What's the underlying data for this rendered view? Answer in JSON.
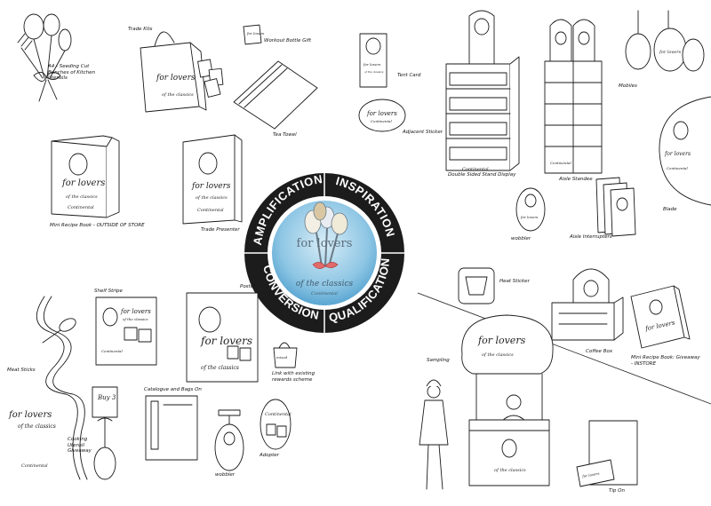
{
  "hub": {
    "ring_words": [
      "AMPLIFICATION",
      "INSPIRATION",
      "QUALIFICATION",
      "CONVERSION"
    ],
    "logo_line1": "for lovers",
    "logo_line2": "of the classics",
    "brand": "Continental"
  },
  "labels": {
    "kitchen_utensils": "A4 - Seeding Cut Bunches of Kitchen Utensils",
    "trade_kits": "Trade Kits",
    "workout_bottle": "Workout Bottle Gift",
    "tea_towel": "Tea Towel",
    "tent_card": "Tent Card",
    "adjacent_sticker": "Adjacent Sticker",
    "floor_stand": "Double Sided Stand Display",
    "aisle_standee": "Aisle Standee",
    "mobiles": "Mobiles",
    "blade": "Blade",
    "wobbler_top": "wobbler",
    "aisle_interrupters": "Aisle Interrupters",
    "mini_recipe_book_top": "Mini Recipe Book - OUTSIDE OF STORE",
    "trade_presenter": "Trade Presenter",
    "shelf_stripe": "Shelf Stripe",
    "poster": "Poster",
    "meat_stick": "Meat Sticks",
    "cataloges": "Catalogue and Bags On",
    "adopter": "Adopter",
    "wobbler_bottom": "wobbler",
    "link_existing": "Link with existing rewards scheme",
    "cooking_utensil": "Cooking Utensil Giveaway",
    "sampling": "Sampling",
    "heat_sticker": "Heat Sticker",
    "coffee_box": "Coffee Box",
    "mini_recipe_book_bottom": "Mini Recipe Book: Giveaway - INSTORE",
    "tip_on": "Tip On"
  },
  "pack": {
    "lovers": "for lovers",
    "classics": "of the classics",
    "brand": "Continental",
    "buy": "Buy 3"
  }
}
